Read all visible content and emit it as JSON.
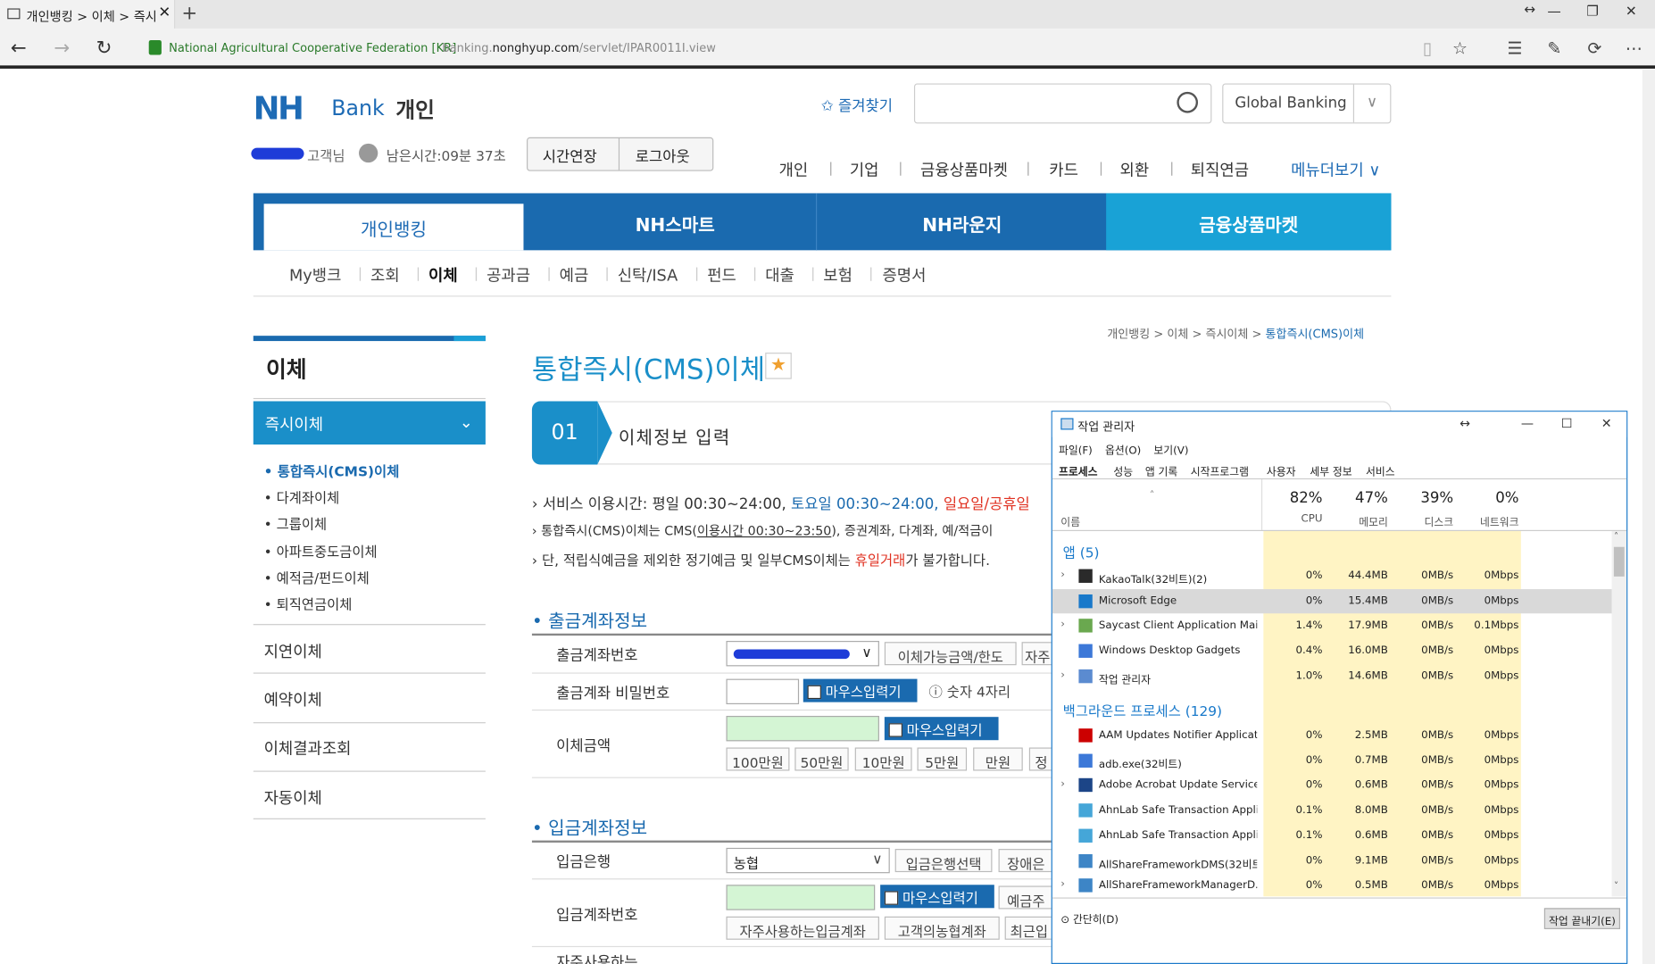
{
  "browser": {
    "tab_title": "개인뱅킹 > 이체 > 즉시",
    "new_tab": "+",
    "site_identity": "National Agricultural Cooperative Federation [KR]",
    "url_pre": "banking.",
    "url_domain": "nonghyup.com",
    "url_path": "/servlet/IPAR0011I.view"
  },
  "header": {
    "logo_nh": "NH",
    "logo_bank": "Bank",
    "logo_section": "개인",
    "favorites": "즐겨찾기",
    "global_banking": "Global Banking",
    "customer_suffix": "고객님",
    "remaining_time": "남은시간:09분 37초",
    "extend_btn": "시간연장",
    "logout_btn": "로그아웃",
    "top_nav": [
      "개인",
      "기업",
      "금융상품마켓",
      "카드",
      "외환",
      "퇴직연금"
    ],
    "more_menu": "메뉴더보기"
  },
  "main_nav": [
    "개인뱅킹",
    "NH스마트",
    "NH라운지",
    "금융상품마켓"
  ],
  "sub_nav": [
    "My뱅크",
    "조회",
    "이체",
    "공과금",
    "예금",
    "신탁/ISA",
    "펀드",
    "대출",
    "보험",
    "증명서"
  ],
  "sidebar": {
    "title": "이체",
    "active": "즉시이체",
    "sub_items": [
      "통합즉시(CMS)이체",
      "다계좌이체",
      "그룹이체",
      "아파트중도금이체",
      "예적금/펀드이체",
      "퇴직연금이체"
    ],
    "menu": [
      "지연이체",
      "예약이체",
      "이체결과조회",
      "자동이체"
    ]
  },
  "breadcrumb": [
    "개인뱅킹",
    "이체",
    "즉시이체",
    "통합즉시(CMS)이체"
  ],
  "page_title": "통합즉시(CMS)이체",
  "step": {
    "num": "01",
    "label": "이체정보 입력"
  },
  "notes": {
    "n1a": "서비스 이용시간: 평일 00:30~24:00, ",
    "n1b": "토요일 00:30~24:00, ",
    "n1c": "일요일/공휴일",
    "n2a": "통합즉시(CMS)이체는 CMS(",
    "n2b": "이용시간 00:30~23:50",
    "n2c": "), 증권계좌, 다계좌, 예/적금이",
    "n3a": "단, 적립식예금을 제외한 정기예금 및 일부CMS이체는 ",
    "n3b": "휴일거래",
    "n3c": "가 불가합니다."
  },
  "withdraw": {
    "heading": "출금계좌정보",
    "account_label": "출금계좌번호",
    "limit_btn": "이체가능금액/한도",
    "self_btn": "자주",
    "pw_label": "출금계좌 비밀번호",
    "mouse_input": "마우스입력기",
    "pw_hint": "숫자 4자리",
    "amount_label": "이체금액",
    "amount_btns": [
      "100만원",
      "50만원",
      "10만원",
      "5만원",
      "만원",
      "정"
    ]
  },
  "deposit": {
    "heading": "입금계좌정보",
    "bank_label": "입금은행",
    "bank_value": "농협",
    "bank_select_btn": "입금은행선택",
    "disabled_btn": "장애은",
    "account_label": "입금계좌번호",
    "mouse_input": "마우스입력기",
    "receiver_btn": "예금주",
    "frequent_btn": "자주사용하는입금계좌",
    "own_btn": "고객의농협계좌",
    "recent_btn": "최근입",
    "next_label": "자주사용하는"
  },
  "task_manager": {
    "title": "작업 관리자",
    "menus": [
      "파일(F)",
      "옵션(O)",
      "보기(V)"
    ],
    "tabs": [
      "프로세스",
      "성능",
      "앱 기록",
      "시작프로그램",
      "사용자",
      "세부 정보",
      "서비스"
    ],
    "name_col": "이름",
    "cols": [
      {
        "pct": "82%",
        "label": "CPU"
      },
      {
        "pct": "47%",
        "label": "메모리"
      },
      {
        "pct": "39%",
        "label": "디스크"
      },
      {
        "pct": "0%",
        "label": "네트워크"
      }
    ],
    "apps_group": "앱 (5)",
    "bg_group": "백그라운드 프로세스 (129)",
    "apps": [
      {
        "name": "KakaoTalk(32비트)(2)",
        "cpu": "0%",
        "mem": "44.4MB",
        "disk": "0MB/s",
        "net": "0Mbps",
        "exp": "›",
        "icon": "#2a2a2a"
      },
      {
        "name": "Microsoft Edge",
        "cpu": "0%",
        "mem": "15.4MB",
        "disk": "0MB/s",
        "net": "0Mbps",
        "exp": "",
        "icon": "#1979ca"
      },
      {
        "name": "Saycast Client Application Mai...",
        "cpu": "1.4%",
        "mem": "17.9MB",
        "disk": "0MB/s",
        "net": "0.1Mbps",
        "exp": "›",
        "icon": "#6aa84f"
      },
      {
        "name": "Windows Desktop Gadgets",
        "cpu": "0.4%",
        "mem": "16.0MB",
        "disk": "0MB/s",
        "net": "0Mbps",
        "exp": "",
        "icon": "#3c78d8"
      },
      {
        "name": "작업 관리자",
        "cpu": "1.0%",
        "mem": "14.6MB",
        "disk": "0MB/s",
        "net": "0Mbps",
        "exp": "›",
        "icon": "#5b8bd0"
      }
    ],
    "bg": [
      {
        "name": "AAM Updates Notifier Applicat...",
        "cpu": "0%",
        "mem": "2.5MB",
        "disk": "0MB/s",
        "net": "0Mbps",
        "exp": "",
        "icon": "#cc0000"
      },
      {
        "name": "adb.exe(32비트)",
        "cpu": "0%",
        "mem": "0.7MB",
        "disk": "0MB/s",
        "net": "0Mbps",
        "exp": "",
        "icon": "#3c78d8"
      },
      {
        "name": "Adobe Acrobat Update Service...",
        "cpu": "0%",
        "mem": "0.6MB",
        "disk": "0MB/s",
        "net": "0Mbps",
        "exp": "›",
        "icon": "#1c4587"
      },
      {
        "name": "AhnLab Safe Transaction Appli...",
        "cpu": "0.1%",
        "mem": "8.0MB",
        "disk": "0MB/s",
        "net": "0Mbps",
        "exp": "",
        "icon": "#45a6d8"
      },
      {
        "name": "AhnLab Safe Transaction Appli...",
        "cpu": "0.1%",
        "mem": "0.6MB",
        "disk": "0MB/s",
        "net": "0Mbps",
        "exp": "",
        "icon": "#45a6d8"
      },
      {
        "name": "AllShareFrameworkDMS(32비트)",
        "cpu": "0%",
        "mem": "9.1MB",
        "disk": "0MB/s",
        "net": "0Mbps",
        "exp": "",
        "icon": "#3d85c6"
      },
      {
        "name": "AllShareFrameworkManagerD...",
        "cpu": "0%",
        "mem": "0.5MB",
        "disk": "0MB/s",
        "net": "0Mbps",
        "exp": "›",
        "icon": "#3d85c6"
      }
    ],
    "collapse": "간단히(D)",
    "end_task": "작업 끝내기(E)"
  },
  "colors": {
    "nh_blue": "#1a6aaf",
    "cyan": "#1a8fc9",
    "tm_accent": "#1979ca",
    "redaction": "#1e3cd8"
  }
}
